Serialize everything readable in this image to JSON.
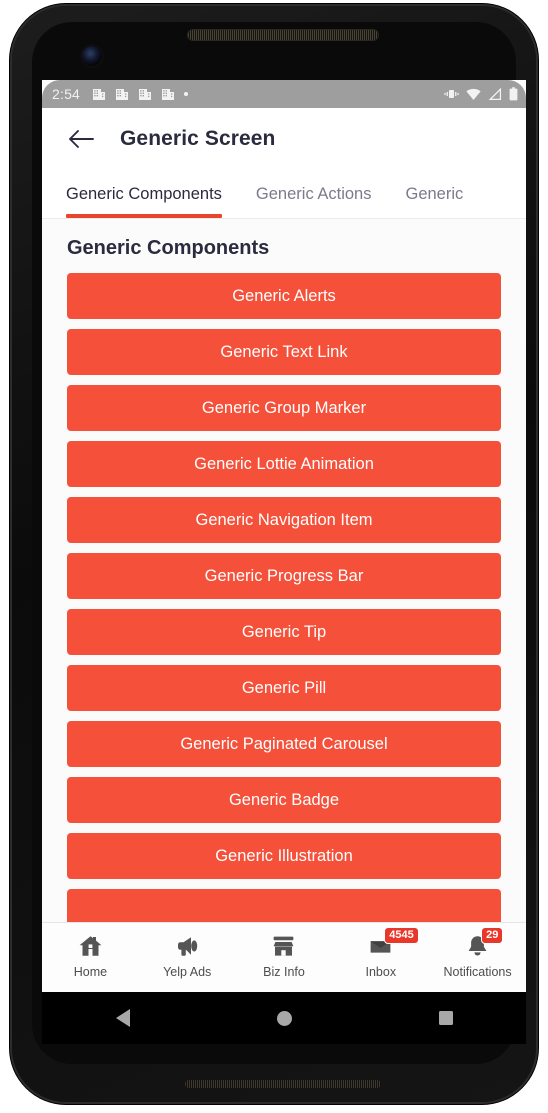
{
  "status_bar": {
    "time": "2:54",
    "left_icons": [
      "business-icon",
      "business-icon",
      "business-icon",
      "business-icon",
      "dot-icon"
    ],
    "right_icons": [
      "vibrate-icon",
      "wifi-icon",
      "cellular-signal-icon",
      "battery-icon"
    ]
  },
  "app_bar": {
    "back_icon": "back-arrow-icon",
    "title": "Generic Screen"
  },
  "tabs": [
    {
      "label": "Generic Components",
      "active": true
    },
    {
      "label": "Generic Actions",
      "active": false
    },
    {
      "label": "Generic",
      "active": false
    }
  ],
  "content": {
    "section_title": "Generic Components",
    "buttons": [
      "Generic Alerts",
      "Generic Text Link",
      "Generic Group Marker",
      "Generic Lottie Animation",
      "Generic Navigation Item",
      "Generic Progress Bar",
      "Generic Tip",
      "Generic Pill",
      "Generic Paginated Carousel",
      "Generic Badge",
      "Generic Illustration",
      ""
    ]
  },
  "bottom_nav": [
    {
      "label": "Home",
      "icon": "home-icon",
      "badge": ""
    },
    {
      "label": "Yelp Ads",
      "icon": "megaphone-icon",
      "badge": ""
    },
    {
      "label": "Biz Info",
      "icon": "storefront-icon",
      "badge": ""
    },
    {
      "label": "Inbox",
      "icon": "inbox-icon",
      "badge": "4545"
    },
    {
      "label": "Notifications",
      "icon": "bell-icon",
      "badge": "29"
    }
  ],
  "android_nav": {
    "back": "android-back-icon",
    "home": "android-home-icon",
    "recents": "android-recents-icon"
  },
  "colors": {
    "accent": "#f4503a",
    "tab_indicator": "#e8452c",
    "badge": "#e8372b",
    "title_text": "#2b2b40"
  }
}
